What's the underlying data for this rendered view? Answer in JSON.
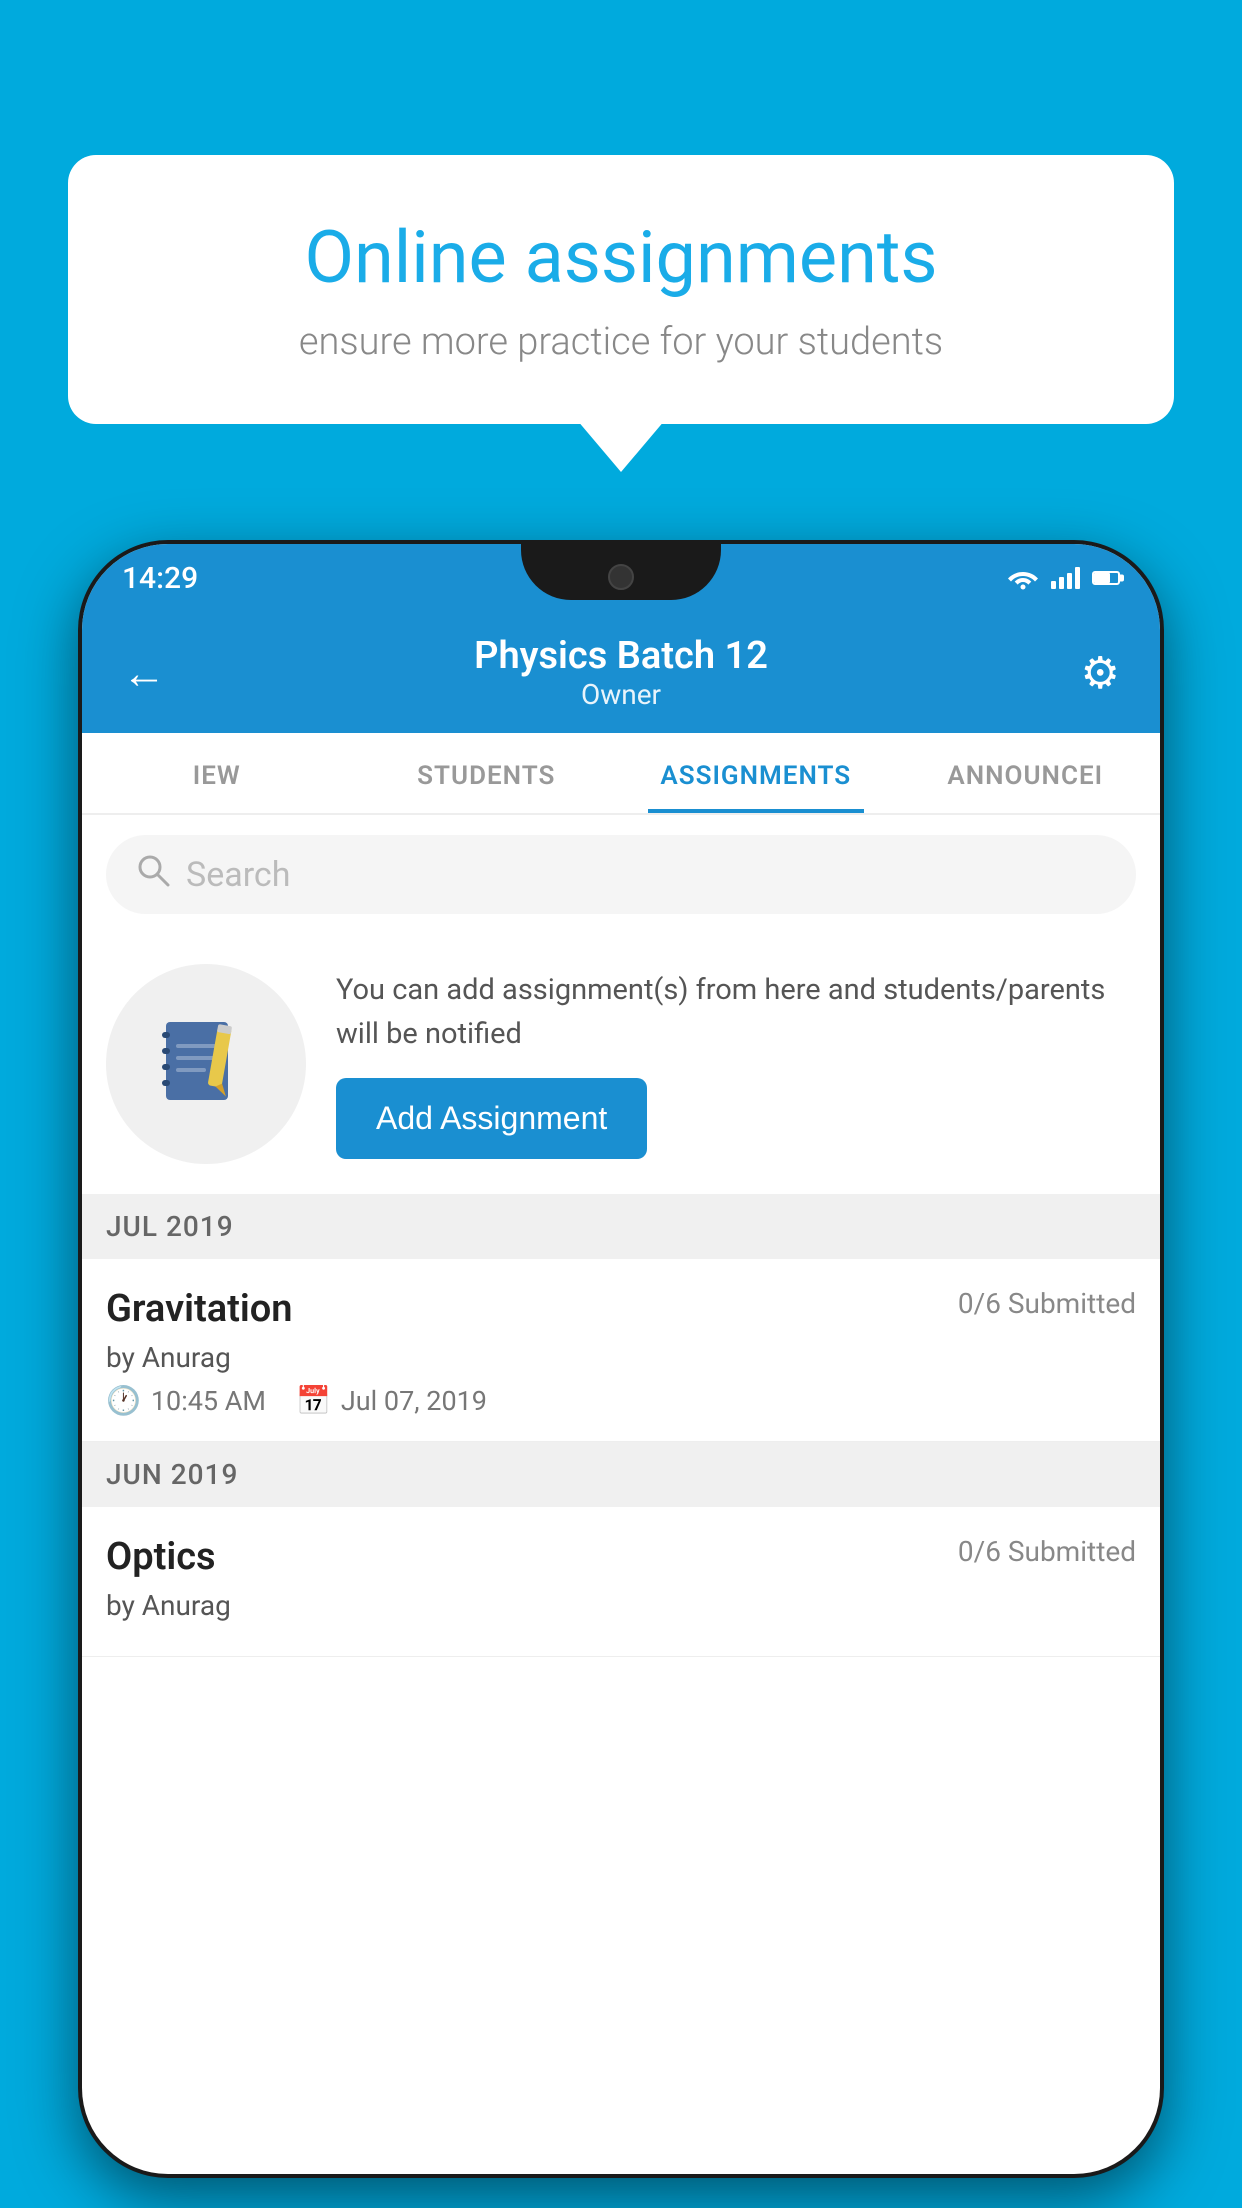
{
  "background_color": "#00AADD",
  "speech_bubble": {
    "title": "Online assignments",
    "subtitle": "ensure more practice for your students"
  },
  "status_bar": {
    "time": "14:29"
  },
  "app_header": {
    "title": "Physics Batch 12",
    "subtitle": "Owner",
    "back_label": "←",
    "settings_label": "⚙"
  },
  "tabs": [
    {
      "label": "IEW",
      "active": false
    },
    {
      "label": "STUDENTS",
      "active": false
    },
    {
      "label": "ASSIGNMENTS",
      "active": true
    },
    {
      "label": "ANNOUNCEI",
      "active": false
    }
  ],
  "search": {
    "placeholder": "Search"
  },
  "promo": {
    "text": "You can add assignment(s) from here and students/parents will be notified",
    "button_label": "Add Assignment"
  },
  "sections": [
    {
      "label": "JUL 2019",
      "assignments": [
        {
          "name": "Gravitation",
          "submitted": "0/6 Submitted",
          "by": "by Anurag",
          "time": "10:45 AM",
          "date": "Jul 07, 2019"
        }
      ]
    },
    {
      "label": "JUN 2019",
      "assignments": [
        {
          "name": "Optics",
          "submitted": "0/6 Submitted",
          "by": "by Anurag",
          "time": "",
          "date": ""
        }
      ]
    }
  ]
}
